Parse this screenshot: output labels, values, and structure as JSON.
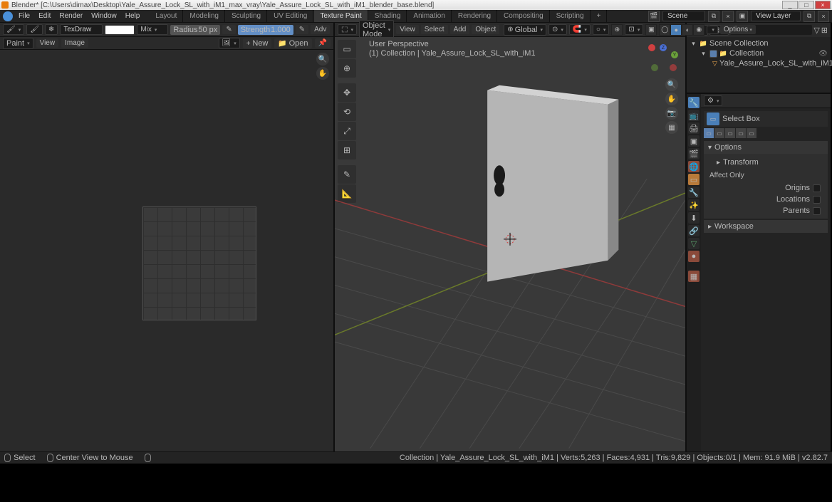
{
  "app": {
    "title": "Blender* [C:\\Users\\dimax\\Desktop\\Yale_Assure_Lock_SL_with_iM1_max_vray\\Yale_Assure_Lock_SL_with_iM1_blender_base.blend]"
  },
  "menu": {
    "file": "File",
    "edit": "Edit",
    "render": "Render",
    "window": "Window",
    "help": "Help"
  },
  "workspaces": {
    "layout": "Layout",
    "modeling": "Modeling",
    "sculpting": "Sculpting",
    "uv": "UV Editing",
    "texpaint": "Texture Paint",
    "shading": "Shading",
    "anim": "Animation",
    "rendering": "Rendering",
    "compositing": "Compositing",
    "scripting": "Scripting",
    "add": "+"
  },
  "scene": {
    "label": "Scene",
    "viewlayer": "View Layer"
  },
  "image_editor": {
    "brush": "TexDraw",
    "blend_label": "Mix",
    "radius_label": "Radius",
    "radius_val": "50 px",
    "strength_label": "Strength",
    "strength_val": "1.000",
    "adv": "Adv",
    "paint_dd": "Paint",
    "view": "View",
    "image": "Image",
    "new": "New",
    "open": "Open"
  },
  "viewport": {
    "mode": "Object Mode",
    "view": "View",
    "select": "Select",
    "add": "Add",
    "object": "Object",
    "orientation": "Global",
    "options": "Options",
    "info_line1": "User Perspective",
    "info_line2": "(1) Collection | Yale_Assure_Lock_SL_with_iM1"
  },
  "outliner": {
    "scene_collection": "Scene Collection",
    "collection": "Collection",
    "object": "Yale_Assure_Lock_SL_with_iM1"
  },
  "properties": {
    "select_box": "Select Box",
    "options": "Options",
    "transform": "Transform",
    "affect_only": "Affect Only",
    "origins": "Origins",
    "locations": "Locations",
    "parents": "Parents",
    "workspace": "Workspace"
  },
  "statusbar": {
    "select": "Select",
    "center": "Center View to Mouse",
    "right": "Collection | Yale_Assure_Lock_SL_with_iM1 | Verts:5,263 | Faces:4,931 | Tris:9,829 | Objects:0/1 | Mem: 91.9 MiB | v2.82.7"
  }
}
